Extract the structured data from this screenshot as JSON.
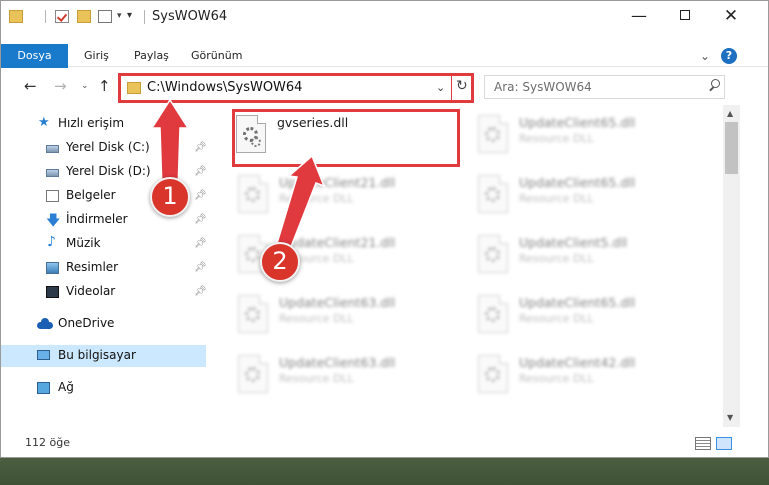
{
  "window": {
    "title": "SysWOW64",
    "controls": {
      "minimize": "—",
      "close": "✕"
    }
  },
  "ribbon": {
    "tabs": [
      "Dosya",
      "Giriş",
      "Paylaş",
      "Görünüm"
    ],
    "help": "?"
  },
  "navigation": {
    "back": "←",
    "forward": "→",
    "up": "↑",
    "address_path": "C:\\Windows\\SysWOW64",
    "search_placeholder": "Ara: SysWOW64"
  },
  "sidebar": {
    "items": [
      {
        "label": "Hızlı erişim",
        "icon": "star-icon"
      },
      {
        "label": "Yerel Disk (C:)",
        "icon": "drive-icon",
        "pinned": true
      },
      {
        "label": "Yerel Disk (D:)",
        "icon": "drive-icon",
        "pinned": true
      },
      {
        "label": "Belgeler",
        "icon": "documents-icon",
        "pinned": true
      },
      {
        "label": "İndirmeler",
        "icon": "download-icon",
        "pinned": true
      },
      {
        "label": "Müzik",
        "icon": "music-icon",
        "pinned": true
      },
      {
        "label": "Resimler",
        "icon": "pictures-icon",
        "pinned": true
      },
      {
        "label": "Videolar",
        "icon": "video-icon",
        "pinned": true
      },
      {
        "label": "OneDrive",
        "icon": "cloud-icon"
      },
      {
        "label": "Bu bilgisayar",
        "icon": "computer-icon",
        "selected": true
      },
      {
        "label": "Ağ",
        "icon": "network-icon"
      }
    ]
  },
  "files": [
    {
      "name": "gvseries.dll",
      "type": "",
      "highlighted": true
    },
    {
      "name": "UpdateClient65.dll",
      "type": "Resource DLL"
    },
    {
      "name": "UpdateClient21.dll",
      "type": "Resource DLL"
    },
    {
      "name": "UpdateClient65.dll",
      "type": "Resource DLL"
    },
    {
      "name": "UpdateClient21.dll",
      "type": "Resource DLL"
    },
    {
      "name": "UpdateClient5.dll",
      "type": "Resource DLL"
    },
    {
      "name": "UpdateClient63.dll",
      "type": "Resource DLL"
    },
    {
      "name": "UpdateClient65.dll",
      "type": "Resource DLL"
    },
    {
      "name": "UpdateClient63.dll",
      "type": "Resource DLL"
    },
    {
      "name": "UpdateClient42.dll",
      "type": "Resource DLL"
    }
  ],
  "status": {
    "item_count": "112 öğe"
  },
  "callouts": [
    {
      "number": "1"
    },
    {
      "number": "2"
    }
  ],
  "colors": {
    "accent": "#1979ca",
    "highlight": "#e0393e",
    "selection": "#cce8ff"
  }
}
